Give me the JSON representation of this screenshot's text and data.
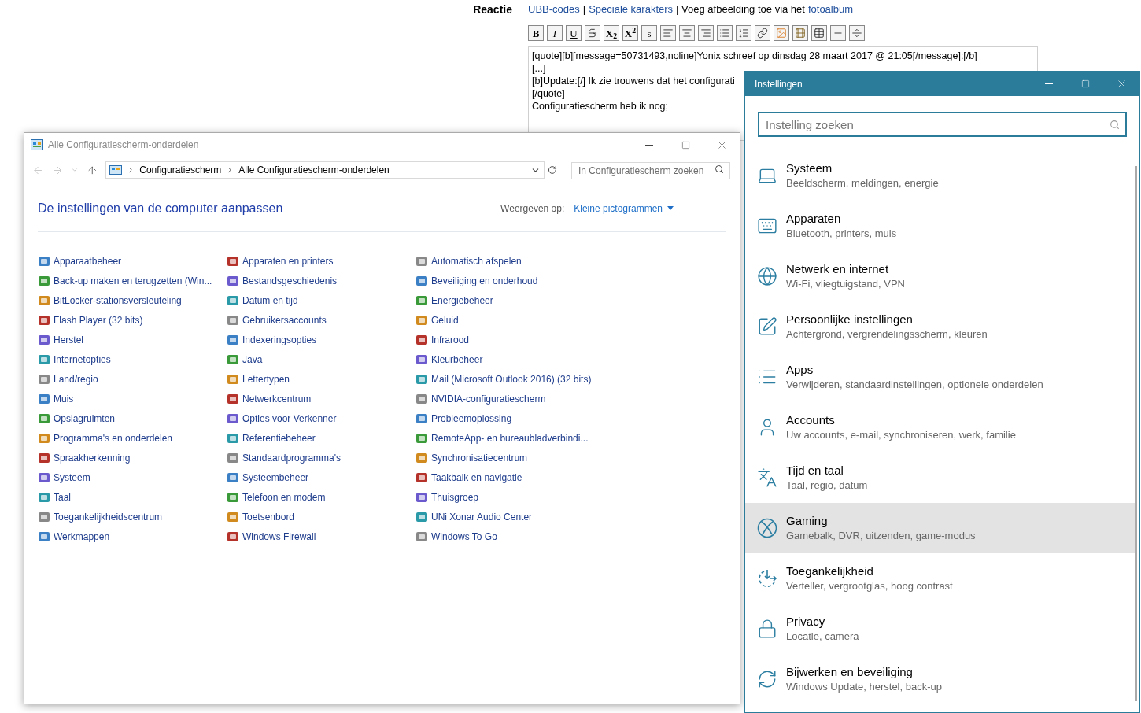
{
  "reply_form": {
    "label": "Reactie",
    "links": [
      {
        "kind": "link",
        "text": "UBB-codes"
      },
      {
        "kind": "sep",
        "text": "|"
      },
      {
        "kind": "link",
        "text": "Speciale karakters"
      },
      {
        "kind": "sep",
        "text": "| Voeg afbeelding toe via het"
      },
      {
        "kind": "link",
        "text": "fotoalbum"
      }
    ],
    "toolbar": [
      {
        "kind": "bold",
        "label": "B"
      },
      {
        "kind": "italic",
        "label": "I"
      },
      {
        "kind": "underline",
        "label": "U"
      },
      {
        "kind": "strike"
      },
      {
        "kind": "text",
        "label": "X$_{2}$"
      },
      {
        "kind": "text",
        "label": "X$^{2}$"
      },
      {
        "kind": "small",
        "label": "s"
      },
      {
        "kind": "align-left"
      },
      {
        "kind": "align-center"
      },
      {
        "kind": "align-right"
      },
      {
        "kind": "bullets"
      },
      {
        "kind": "numbers"
      },
      {
        "kind": "link"
      },
      {
        "kind": "image"
      },
      {
        "kind": "video"
      },
      {
        "kind": "table"
      },
      {
        "kind": "rule"
      },
      {
        "kind": "break"
      }
    ],
    "lines": [
      "[quote][b][message=50731493,noline]Yonix schreef op dinsdag 28 maart 2017 @ 21:05[/message]:[/b]",
      "[...]",
      "[b]Update:[/] Ik zie trouwens dat het configurati",
      "[/quote]",
      "Configuratiescherm heb ik nog;"
    ]
  },
  "control_panel": {
    "title": "Alle Configuratiescherm-onderdelen",
    "breadcrumbs": [
      "Configuratiescherm",
      "Alle Configuratiescherm-onderdelen"
    ],
    "search": {
      "placeholder": "In Configuratiescherm zoeken"
    },
    "heading": "De instellingen van de computer aanpassen",
    "view_label": "Weergeven op:",
    "view_value": "Kleine pictogrammen",
    "columns": [
      [
        "Apparaatbeheer",
        "Back-up maken en terugzetten (Win...",
        "BitLocker-stationsversleuteling",
        "Flash Player (32 bits)",
        "Herstel",
        "Internetopties",
        "Land/regio",
        "Muis",
        "Opslagruimten",
        "Programma's en onderdelen",
        "Spraakherkenning",
        "Systeem",
        "Taal",
        "Toegankelijkheidscentrum",
        "Werkmappen"
      ],
      [
        "Apparaten en printers",
        "Bestandsgeschiedenis",
        "Datum en tijd",
        "Gebruikersaccounts",
        "Indexeringsopties",
        "Java",
        "Lettertypen",
        "Netwerkcentrum",
        "Opties voor Verkenner",
        "Referentiebeheer",
        "Standaardprogramma's",
        "Systeembeheer",
        "Telefoon en modem",
        "Toetsenbord",
        "Windows Firewall"
      ],
      [
        "Automatisch afspelen",
        "Beveiliging en onderhoud",
        "Energiebeheer",
        "Geluid",
        "Infrarood",
        "Kleurbeheer",
        "Mail (Microsoft Outlook 2016) (32 bits)",
        "NVIDIA-configuratiescherm",
        "Probleemoplossing",
        "RemoteApp- en bureaubladverbindi...",
        "Synchronisatiecentrum",
        "Taakbalk en navigatie",
        "Thuisgroep",
        "UNi Xonar Audio Center",
        "Windows To Go"
      ]
    ]
  },
  "settings": {
    "title": "Instellingen",
    "search": {
      "placeholder": "Instelling zoeken"
    },
    "items": [
      {
        "kind": "system",
        "title": "Systeem",
        "subtitle": "Beeldscherm, meldingen, energie",
        "selected": false
      },
      {
        "kind": "devices",
        "title": "Apparaten",
        "subtitle": "Bluetooth, printers, muis",
        "selected": false
      },
      {
        "kind": "network",
        "title": "Netwerk en internet",
        "subtitle": "Wi-Fi, vliegtuigstand, VPN",
        "selected": false
      },
      {
        "kind": "personal",
        "title": "Persoonlijke instellingen",
        "subtitle": "Achtergrond, vergrendelingsscherm, kleuren",
        "selected": false
      },
      {
        "kind": "apps",
        "title": "Apps",
        "subtitle": "Verwijderen, standaardinstellingen, optionele onderdelen",
        "selected": false
      },
      {
        "kind": "accounts",
        "title": "Accounts",
        "subtitle": "Uw accounts, e-mail, synchroniseren, werk, familie",
        "selected": false
      },
      {
        "kind": "time",
        "title": "Tijd en taal",
        "subtitle": "Taal, regio, datum",
        "selected": false
      },
      {
        "kind": "gaming",
        "title": "Gaming",
        "subtitle": "Gamebalk, DVR, uitzenden, game-modus",
        "selected": true
      },
      {
        "kind": "access",
        "title": "Toegankelijkheid",
        "subtitle": "Verteller, vergrootglas, hoog contrast",
        "selected": false
      },
      {
        "kind": "privacy",
        "title": "Privacy",
        "subtitle": "Locatie, camera",
        "selected": false
      },
      {
        "kind": "update",
        "title": "Bijwerken en beveiliging",
        "subtitle": "Windows Update, herstel, back-up",
        "selected": false
      }
    ]
  }
}
